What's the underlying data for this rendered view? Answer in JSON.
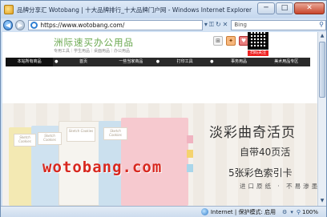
{
  "window": {
    "title": "品牌分享汇 Wotobang | 十大品牌排行_十大品牌门户网 - Windows Internet Explorer",
    "minimize": "─",
    "maximize": "□",
    "close": "✕"
  },
  "address": {
    "back": "◀",
    "forward": "▶",
    "url": "https://www.wotobang.com/",
    "tools": [
      "▾",
      "⚿",
      "↻",
      "✕"
    ],
    "search_placeholder": "Bing"
  },
  "site": {
    "logo": "洲际速买办公用品",
    "slogan": "专用工具｜学生用品｜桌面用品｜办公用品",
    "qr_caption": "扫码关注"
  },
  "navbar": {
    "items": [
      "本站所有商品",
      "首页",
      "一些当家商品",
      "打印工具",
      "事务用品",
      "美术用品专区"
    ]
  },
  "banner": {
    "title": "淡彩曲奇活页",
    "sub1": "自带40页活",
    "sub2": "5张彩色索引卡",
    "sub3": "进口原纸 · 不易渗墨",
    "card_text": "Sketch Cookies"
  },
  "watermark": "wotobang.com",
  "status": {
    "zone": "Internet | 保护模式: 启用",
    "zoom": "100%"
  }
}
